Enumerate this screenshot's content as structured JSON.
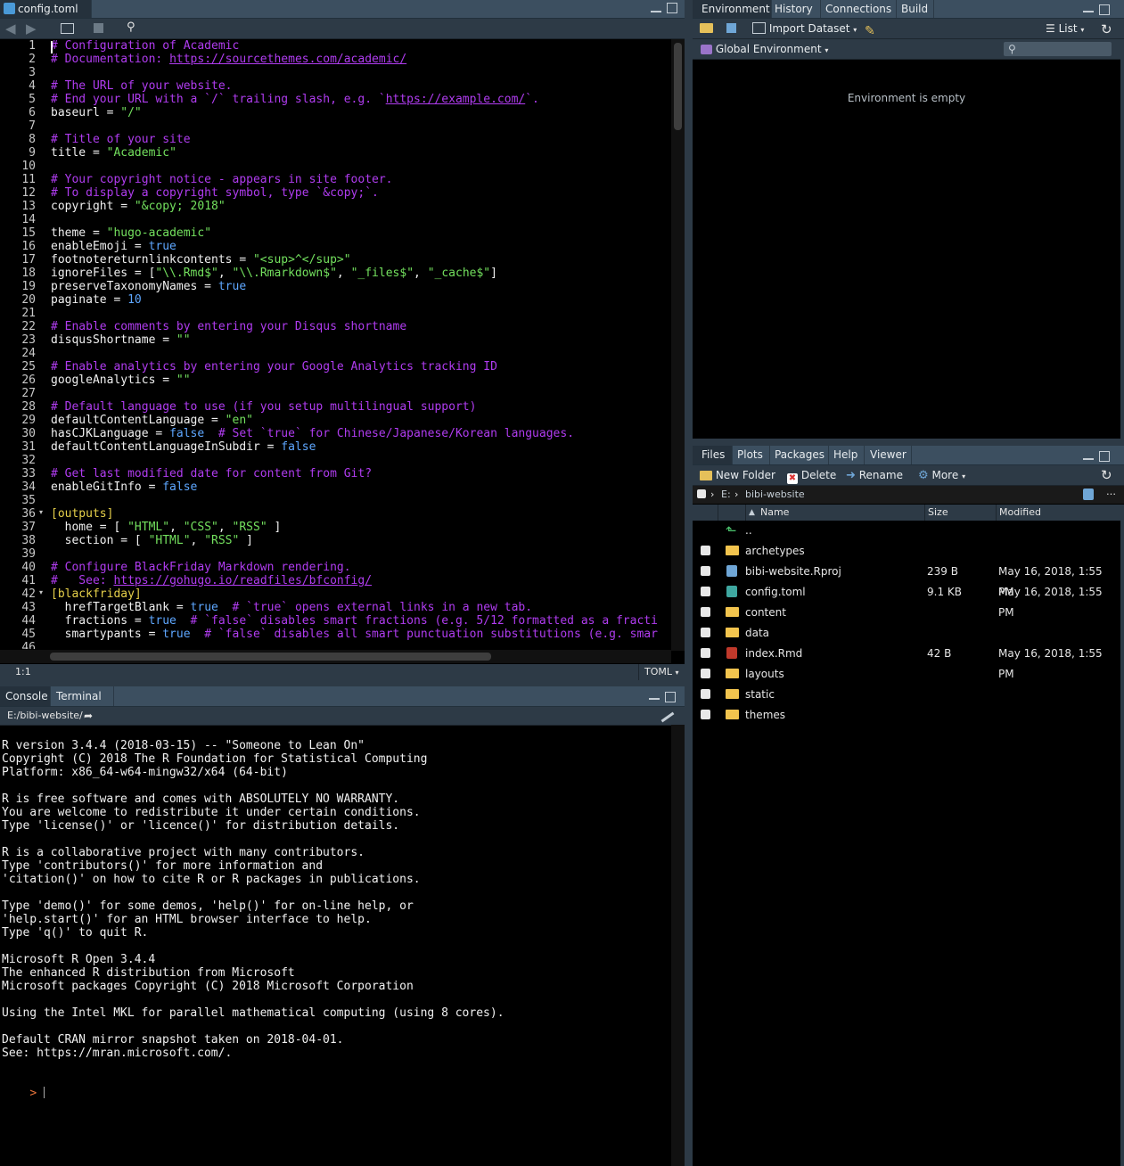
{
  "editor": {
    "tab_title": "config.toml",
    "tab_icon": "toml-file-icon",
    "cursor_pos": "1:1",
    "file_type": "TOML",
    "lines": [
      {
        "n": "1",
        "segs": [
          [
            "cm",
            "# Configuration of Academic"
          ]
        ]
      },
      {
        "n": "2",
        "segs": [
          [
            "cm",
            "# Documentation: "
          ],
          [
            "lnk",
            "https://sourcethemes.com/academic/"
          ]
        ]
      },
      {
        "n": "3",
        "segs": []
      },
      {
        "n": "4",
        "segs": [
          [
            "cm",
            "# The URL of your website."
          ]
        ]
      },
      {
        "n": "5",
        "segs": [
          [
            "cm",
            "# End your URL with a `/` trailing slash, e.g. `"
          ],
          [
            "lnk",
            "https://example.com/"
          ],
          [
            "cm",
            "`."
          ]
        ]
      },
      {
        "n": "6",
        "segs": [
          [
            "t",
            "baseurl = "
          ],
          [
            "str",
            "\"/\""
          ]
        ]
      },
      {
        "n": "7",
        "segs": []
      },
      {
        "n": "8",
        "segs": [
          [
            "cm",
            "# Title of your site"
          ]
        ]
      },
      {
        "n": "9",
        "segs": [
          [
            "t",
            "title = "
          ],
          [
            "str",
            "\"Academic\""
          ]
        ]
      },
      {
        "n": "10",
        "segs": []
      },
      {
        "n": "11",
        "segs": [
          [
            "cm",
            "# Your copyright notice - appears in site footer."
          ]
        ]
      },
      {
        "n": "12",
        "segs": [
          [
            "cm",
            "# To display a copyright symbol, type `&copy;`."
          ]
        ]
      },
      {
        "n": "13",
        "segs": [
          [
            "t",
            "copyright = "
          ],
          [
            "str",
            "\"&copy; 2018\""
          ]
        ]
      },
      {
        "n": "14",
        "segs": []
      },
      {
        "n": "15",
        "segs": [
          [
            "t",
            "theme = "
          ],
          [
            "str",
            "\"hugo-academic\""
          ]
        ]
      },
      {
        "n": "16",
        "segs": [
          [
            "t",
            "enableEmoji = "
          ],
          [
            "kw",
            "true"
          ]
        ]
      },
      {
        "n": "17",
        "segs": [
          [
            "t",
            "footnotereturnlinkcontents = "
          ],
          [
            "str",
            "\"<sup>^</sup>\""
          ]
        ]
      },
      {
        "n": "18",
        "segs": [
          [
            "t",
            "ignoreFiles = ["
          ],
          [
            "str",
            "\"\\\\.Rmd$\""
          ],
          [
            "t",
            ", "
          ],
          [
            "str",
            "\"\\\\.Rmarkdown$\""
          ],
          [
            "t",
            ", "
          ],
          [
            "str",
            "\"_files$\""
          ],
          [
            "t",
            ", "
          ],
          [
            "str",
            "\"_cache$\""
          ],
          [
            "t",
            "]"
          ]
        ]
      },
      {
        "n": "19",
        "segs": [
          [
            "t",
            "preserveTaxonomyNames = "
          ],
          [
            "kw",
            "true"
          ]
        ]
      },
      {
        "n": "20",
        "segs": [
          [
            "t",
            "paginate = "
          ],
          [
            "num",
            "10"
          ]
        ]
      },
      {
        "n": "21",
        "segs": []
      },
      {
        "n": "22",
        "segs": [
          [
            "cm",
            "# Enable comments by entering your Disqus shortname"
          ]
        ]
      },
      {
        "n": "23",
        "segs": [
          [
            "t",
            "disqusShortname = "
          ],
          [
            "str",
            "\"\""
          ]
        ]
      },
      {
        "n": "24",
        "segs": []
      },
      {
        "n": "25",
        "segs": [
          [
            "cm",
            "# Enable analytics by entering your Google Analytics tracking ID"
          ]
        ]
      },
      {
        "n": "26",
        "segs": [
          [
            "t",
            "googleAnalytics = "
          ],
          [
            "str",
            "\"\""
          ]
        ]
      },
      {
        "n": "27",
        "segs": []
      },
      {
        "n": "28",
        "segs": [
          [
            "cm",
            "# Default language to use (if you setup multilingual support)"
          ]
        ]
      },
      {
        "n": "29",
        "segs": [
          [
            "t",
            "defaultContentLanguage = "
          ],
          [
            "str",
            "\"en\""
          ]
        ]
      },
      {
        "n": "30",
        "segs": [
          [
            "t",
            "hasCJKLanguage = "
          ],
          [
            "kw",
            "false"
          ],
          [
            "cm",
            "  # Set `true` for Chinese/Japanese/Korean languages."
          ]
        ]
      },
      {
        "n": "31",
        "segs": [
          [
            "t",
            "defaultContentLanguageInSubdir = "
          ],
          [
            "kw",
            "false"
          ]
        ]
      },
      {
        "n": "32",
        "segs": []
      },
      {
        "n": "33",
        "segs": [
          [
            "cm",
            "# Get last modified date for content from Git?"
          ]
        ]
      },
      {
        "n": "34",
        "segs": [
          [
            "t",
            "enableGitInfo = "
          ],
          [
            "kw",
            "false"
          ]
        ]
      },
      {
        "n": "35",
        "segs": []
      },
      {
        "n": "36",
        "segs": [
          [
            "sec",
            "[outputs]"
          ]
        ]
      },
      {
        "n": "37",
        "segs": [
          [
            "t",
            "  home = [ "
          ],
          [
            "str",
            "\"HTML\""
          ],
          [
            "t",
            ", "
          ],
          [
            "str",
            "\"CSS\""
          ],
          [
            "t",
            ", "
          ],
          [
            "str",
            "\"RSS\""
          ],
          [
            "t",
            " ]"
          ]
        ]
      },
      {
        "n": "38",
        "segs": [
          [
            "t",
            "  section = [ "
          ],
          [
            "str",
            "\"HTML\""
          ],
          [
            "t",
            ", "
          ],
          [
            "str",
            "\"RSS\""
          ],
          [
            "t",
            " ]"
          ]
        ]
      },
      {
        "n": "39",
        "segs": []
      },
      {
        "n": "40",
        "segs": [
          [
            "cm",
            "# Configure BlackFriday Markdown rendering."
          ]
        ]
      },
      {
        "n": "41",
        "segs": [
          [
            "cm",
            "#   See: "
          ],
          [
            "lnk",
            "https://gohugo.io/readfiles/bfconfig/"
          ]
        ]
      },
      {
        "n": "42",
        "segs": [
          [
            "sec",
            "[blackfriday]"
          ]
        ]
      },
      {
        "n": "43",
        "segs": [
          [
            "t",
            "  hrefTargetBlank = "
          ],
          [
            "kw",
            "true"
          ],
          [
            "cm",
            "  # `true` opens external links in a new tab."
          ]
        ]
      },
      {
        "n": "44",
        "segs": [
          [
            "t",
            "  fractions = "
          ],
          [
            "kw",
            "true"
          ],
          [
            "cm",
            "  # `false` disables smart fractions (e.g. 5/12 formatted as a fracti"
          ]
        ]
      },
      {
        "n": "45",
        "segs": [
          [
            "t",
            "  smartypants = "
          ],
          [
            "kw",
            "true"
          ],
          [
            "cm",
            "  # `false` disables all smart punctuation substitutions (e.g. smar"
          ]
        ]
      },
      {
        "n": "46",
        "segs": []
      },
      {
        "n": "47",
        "segs": []
      }
    ]
  },
  "console": {
    "tabs": [
      "Console",
      "Terminal"
    ],
    "path": "E:/bibi-website/",
    "lines": [
      "R version 3.4.4 (2018-03-15) -- \"Someone to Lean On\"",
      "Copyright (C) 2018 The R Foundation for Statistical Computing",
      "Platform: x86_64-w64-mingw32/x64 (64-bit)",
      "",
      "R is free software and comes with ABSOLUTELY NO WARRANTY.",
      "You are welcome to redistribute it under certain conditions.",
      "Type 'license()' or 'licence()' for distribution details.",
      "",
      "R is a collaborative project with many contributors.",
      "Type 'contributors()' for more information and",
      "'citation()' on how to cite R or R packages in publications.",
      "",
      "Type 'demo()' for some demos, 'help()' for on-line help, or",
      "'help.start()' for an HTML browser interface to help.",
      "Type 'q()' to quit R.",
      "",
      "Microsoft R Open 3.4.4",
      "The enhanced R distribution from Microsoft",
      "Microsoft packages Copyright (C) 2018 Microsoft Corporation",
      "",
      "Using the Intel MKL for parallel mathematical computing (using 8 cores).",
      "",
      "Default CRAN mirror snapshot taken on 2018-04-01.",
      "See: https://mran.microsoft.com/."
    ],
    "prompt": ">"
  },
  "env": {
    "tabs": [
      "Environment",
      "History",
      "Connections",
      "Build"
    ],
    "import_label": "Import Dataset",
    "list_label": "List",
    "scope_label": "Global Environment",
    "empty_text": "Environment is empty"
  },
  "files": {
    "tabs": [
      "Files",
      "Plots",
      "Packages",
      "Help",
      "Viewer"
    ],
    "new_folder": "New Folder",
    "delete": "Delete",
    "rename": "Rename",
    "more": "More",
    "crumb_drive": "E:",
    "crumb_folder": "bibi-website",
    "col_name": "Name",
    "col_size": "Size",
    "col_modified": "Modified",
    "up": "..",
    "rows": [
      {
        "name": "archetypes",
        "size": "",
        "modified": "",
        "icon": "folder-icon"
      },
      {
        "name": "bibi-website.Rproj",
        "size": "239 B",
        "modified": "May 16, 2018, 1:55 PM",
        "icon": "rproj-file-icon"
      },
      {
        "name": "config.toml",
        "size": "9.1 KB",
        "modified": "May 16, 2018, 1:55 PM",
        "icon": "toml-file-icon"
      },
      {
        "name": "content",
        "size": "",
        "modified": "",
        "icon": "folder-icon"
      },
      {
        "name": "data",
        "size": "",
        "modified": "",
        "icon": "folder-icon"
      },
      {
        "name": "index.Rmd",
        "size": "42 B",
        "modified": "May 16, 2018, 1:55 PM",
        "icon": "rmd-file-icon"
      },
      {
        "name": "layouts",
        "size": "",
        "modified": "",
        "icon": "folder-icon"
      },
      {
        "name": "static",
        "size": "",
        "modified": "",
        "icon": "folder-icon"
      },
      {
        "name": "themes",
        "size": "",
        "modified": "",
        "icon": "folder-icon"
      }
    ]
  }
}
